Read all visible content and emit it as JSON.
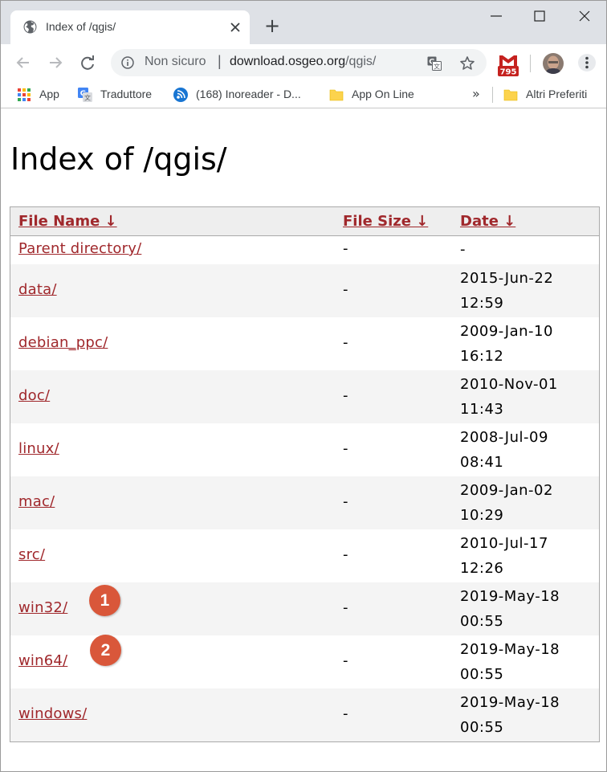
{
  "browser": {
    "tab": {
      "title": "Index of /qgis/",
      "favicon": "globe-icon"
    },
    "new_tab": "+",
    "omnibox": {
      "security_label": "Non sicuro",
      "separator": "|",
      "host": "download.osgeo.org",
      "path": "/qgis/"
    },
    "gmail_badge": "795",
    "bookmarks": [
      {
        "label": "App",
        "icon": "apps-grid-icon"
      },
      {
        "label": "Traduttore",
        "icon": "google-translate-icon"
      },
      {
        "label": "(168) Inoreader - D...",
        "icon": "inoreader-icon"
      },
      {
        "label": "App On Line",
        "icon": "folder-icon"
      }
    ],
    "bookmarks_overflow": "»",
    "other_bookmarks": {
      "label": "Altri Preferiti",
      "icon": "folder-icon"
    }
  },
  "page": {
    "title": "Index of /qgis/",
    "columns": {
      "name": "File Name  ↓",
      "size": "File Size  ↓",
      "date": "Date  ↓"
    },
    "rows": [
      {
        "name": "Parent directory/",
        "size": "-",
        "date": "-"
      },
      {
        "name": "data/",
        "size": "-",
        "date": "2015-Jun-22 12:59"
      },
      {
        "name": "debian_ppc/",
        "size": "-",
        "date": "2009-Jan-10 16:12"
      },
      {
        "name": "doc/",
        "size": "-",
        "date": "2010-Nov-01 11:43"
      },
      {
        "name": "linux/",
        "size": "-",
        "date": "2008-Jul-09 08:41"
      },
      {
        "name": "mac/",
        "size": "-",
        "date": "2009-Jan-02 10:29"
      },
      {
        "name": "src/",
        "size": "-",
        "date": "2010-Jul-17 12:26"
      },
      {
        "name": "win32/",
        "size": "-",
        "date": "2019-May-18 00:55"
      },
      {
        "name": "win64/",
        "size": "-",
        "date": "2019-May-18 00:55"
      },
      {
        "name": "windows/",
        "size": "-",
        "date": "2019-May-18 00:55"
      }
    ],
    "callouts": [
      "1",
      "2"
    ]
  },
  "colors": {
    "link": "#a0282c",
    "callout": "#d9573a",
    "tabstrip": "#dee1e6",
    "row_alt": "#f4f4f4"
  }
}
